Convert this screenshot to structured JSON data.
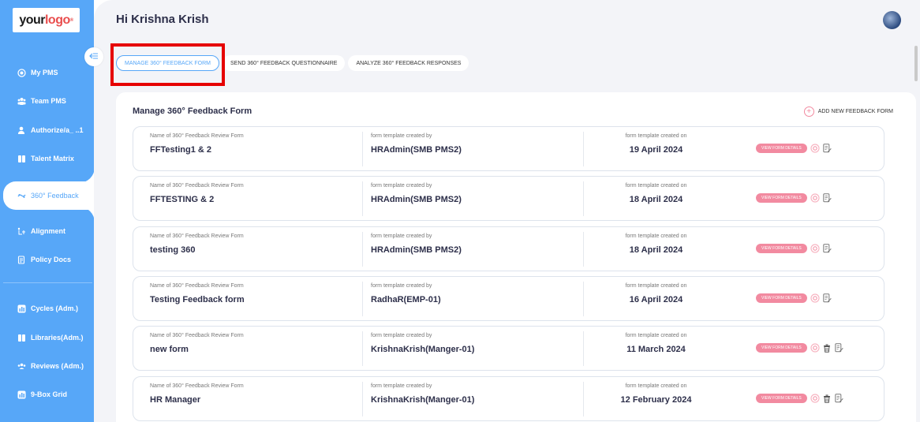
{
  "logo": {
    "part1": "your",
    "part2": "logo",
    "reg": "®"
  },
  "sidebar": {
    "items": [
      {
        "label": "My PMS",
        "icon": "target-icon"
      },
      {
        "label": "Team PMS",
        "icon": "team-icon"
      },
      {
        "label": "Authorize/a_ ..1",
        "icon": "user-check-icon"
      },
      {
        "label": "Talent Matrix",
        "icon": "book-icon"
      },
      {
        "label": "360° Feedback",
        "icon": "feedback-icon",
        "active": true
      },
      {
        "label": "Alignment",
        "icon": "alignment-icon"
      },
      {
        "label": "Policy Docs",
        "icon": "document-icon"
      },
      {
        "label": "Cycles (Adm.)",
        "icon": "chart-icon"
      },
      {
        "label": "Libraries(Adm.)",
        "icon": "book-icon"
      },
      {
        "label": "Reviews (Adm.)",
        "icon": "group-icon"
      },
      {
        "label": "9-Box Grid",
        "icon": "chart-icon"
      }
    ]
  },
  "header": {
    "greeting": "Hi Krishna Krish"
  },
  "tabs": [
    {
      "label": "MANAGE 360° FEEDBACK FORM",
      "active": true
    },
    {
      "label": "SEND 360° FEEDBACK QUESTIONNAIRE"
    },
    {
      "label": "ANALYZE 360° FEEDBACK RESPONSES"
    }
  ],
  "panel": {
    "title": "Manage 360° Feedback Form",
    "add_new_label": "ADD NEW FEEDBACK FORM",
    "col_labels": {
      "name": "Name of 360° Feedback Review Form",
      "created_by": "form template created by",
      "created_on": "form template created on"
    },
    "view_label": "VIEW FORM DETAILS",
    "forms": [
      {
        "name": "FFTesting1 & 2",
        "created_by": "HRAdmin(SMB PMS2)",
        "created_on": "19 April 2024",
        "deletable": false
      },
      {
        "name": "FFTESTING & 2",
        "created_by": "HRAdmin(SMB PMS2)",
        "created_on": "18 April 2024",
        "deletable": false
      },
      {
        "name": "testing 360",
        "created_by": "HRAdmin(SMB PMS2)",
        "created_on": "18 April 2024",
        "deletable": false
      },
      {
        "name": "Testing Feedback form",
        "created_by": "RadhaR(EMP-01)",
        "created_on": "16 April 2024",
        "deletable": false
      },
      {
        "name": "new form",
        "created_by": "KrishnaKrish(Manger-01)",
        "created_on": "11 March 2024",
        "deletable": true
      },
      {
        "name": "HR Manager",
        "created_by": "KrishnaKrish(Manger-01)",
        "created_on": "12 February 2024",
        "deletable": true
      }
    ]
  },
  "colors": {
    "accent": "#57a7f8",
    "pink": "#f28aa0",
    "highlight": "#e60000"
  }
}
